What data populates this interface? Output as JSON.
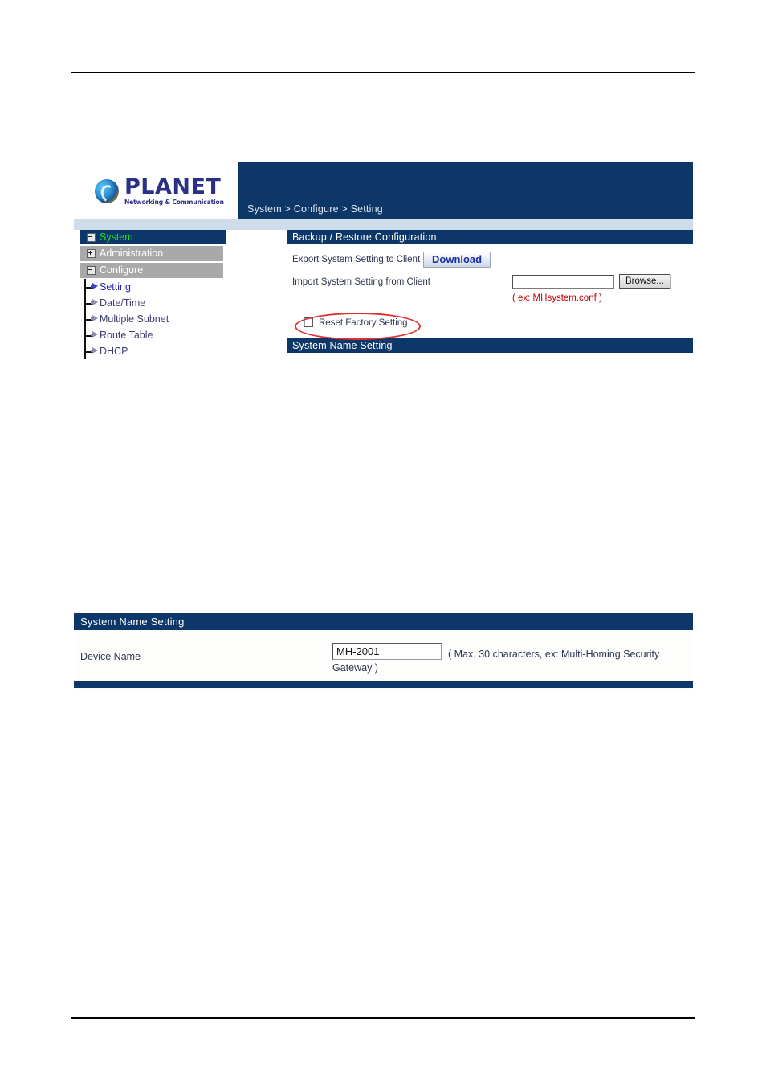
{
  "document": {
    "rules": [
      "top-rule",
      "bottom-rule"
    ]
  },
  "figure_ui": {
    "brand": {
      "name": "PLANET",
      "tagline": "Networking & Communication",
      "logo_icon": "planet-globe-icon"
    },
    "breadcrumb": "System > Configure > Setting",
    "sidebar": {
      "root": {
        "label": "System",
        "toggle": "minus",
        "state": "expanded"
      },
      "groups": [
        {
          "label": "Administration",
          "toggle": "plus",
          "state": "collapsed"
        },
        {
          "label": "Configure",
          "toggle": "minus",
          "state": "expanded"
        }
      ],
      "leaves": [
        {
          "label": "Setting",
          "active": true
        },
        {
          "label": "Date/Time",
          "active": false
        },
        {
          "label": "Multiple Subnet",
          "active": false
        },
        {
          "label": "Route Table",
          "active": false
        },
        {
          "label": "DHCP",
          "active": false
        }
      ]
    },
    "main": {
      "panel_title": "Backup / Restore Configuration",
      "export_label": "Export System Setting to Client",
      "download_button": "Download",
      "import_label": "Import System Setting from Client",
      "import_value": "",
      "import_placeholder": "",
      "browse_button": "Browse...",
      "file_hint": "( ex: MHsystem.conf )",
      "reset_checkbox_label": "Reset Factory Setting",
      "reset_checkbox_checked": false,
      "next_panel_title": "System Name Setting"
    },
    "annotation": {
      "type": "red-ellipse",
      "targets": "reset-factory-setting-checkbox",
      "color": "#e03131"
    }
  },
  "figure_name": {
    "panel_title": "System Name Setting",
    "device_name_label": "Device Name",
    "device_name_value": "MH-2001",
    "note_line1": "( Max. 30 characters, ex: Multi-Homing Security",
    "note_line2": "Gateway )"
  },
  "colors": {
    "header_navy": "#0d3768",
    "subbar_blue": "#cfdcea",
    "nav_group_gray": "#a9a9a9",
    "nav_root_text_green": "#1ee61e",
    "link_blue": "#2222aa",
    "hint_red": "#c00000",
    "annotation_red": "#e03131"
  }
}
